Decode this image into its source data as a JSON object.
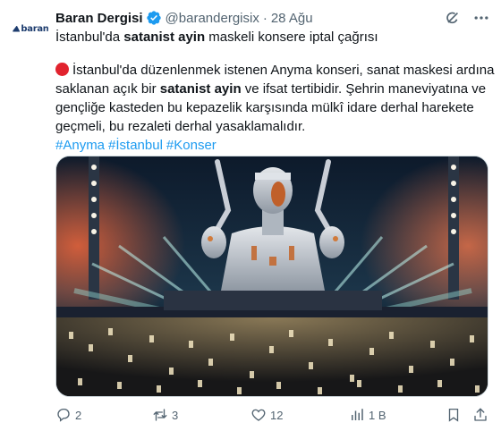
{
  "tweet": {
    "display_name": "Baran Dergisi",
    "handle": "@barandergisix",
    "separator": "·",
    "date": "28 Ağu",
    "avatar_text": "baran",
    "title_line": {
      "part1": "İstanbul'da ",
      "bold": "satanist ayin",
      "part2": " maskeli konsere iptal çağrısı"
    },
    "body": {
      "line1": "İstanbul'da düzenlenmek istenen Anyma konseri, sanat maskesi ardına",
      "line2_part1": "saklanan açık bir ",
      "line2_bold": "satanist ayin",
      "line2_part2": " ve ifsat tertibidir. Şehrin maneviyatına ve",
      "line3": "gençliğe kasteden bu kepazelik karşısında mülkî idare derhal harekete",
      "line4": "geçmeli, bu rezaleti derhal yasaklamalıdır."
    },
    "hashtags": [
      "#Anyma",
      "#İstanbul",
      "#Konser"
    ]
  },
  "actions": {
    "replies": "2",
    "reposts": "3",
    "likes": "12",
    "views": "1 B"
  },
  "icons": {
    "verified": "verified-badge-icon",
    "grok": "grok-icon",
    "more": "more-icon",
    "reply": "reply-icon",
    "repost": "repost-icon",
    "like": "heart-icon",
    "views": "views-icon",
    "bookmark": "bookmark-icon",
    "share": "share-icon"
  },
  "colors": {
    "accent": "#1d9bf0",
    "text": "#0f1419",
    "muted": "#536471",
    "emoji_red": "#e1232e"
  }
}
